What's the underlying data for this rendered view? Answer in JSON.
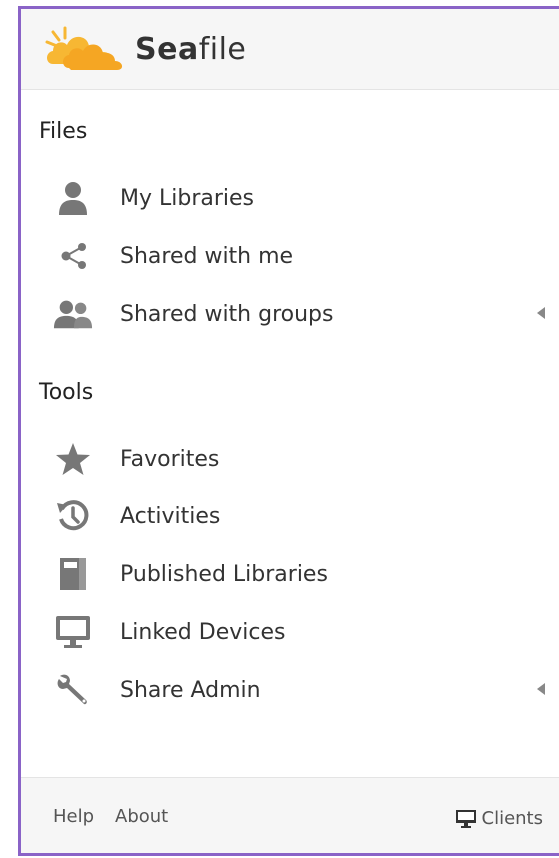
{
  "brand": {
    "name_bold": "Sea",
    "name_rest": "file",
    "logo_colors": [
      "#f5a623",
      "#f7b733"
    ]
  },
  "colors": {
    "frame_border": "#8a63c7",
    "icon_gray": "#777777",
    "text": "#333333"
  },
  "files_section": {
    "title": "Files",
    "items": [
      {
        "label": "My Libraries",
        "icon": "user-icon",
        "has_caret": false
      },
      {
        "label": "Shared with me",
        "icon": "share-icon",
        "has_caret": false
      },
      {
        "label": "Shared with groups",
        "icon": "group-icon",
        "has_caret": true
      }
    ]
  },
  "tools_section": {
    "title": "Tools",
    "items": [
      {
        "label": "Favorites",
        "icon": "star-icon",
        "has_caret": false
      },
      {
        "label": "Activities",
        "icon": "history-icon",
        "has_caret": false
      },
      {
        "label": "Published Libraries",
        "icon": "book-icon",
        "has_caret": false
      },
      {
        "label": "Linked Devices",
        "icon": "monitor-icon",
        "has_caret": false
      },
      {
        "label": "Share Admin",
        "icon": "wrench-icon",
        "has_caret": true
      }
    ]
  },
  "footer": {
    "help": "Help",
    "about": "About",
    "clients": "Clients",
    "clients_icon": "desktop-icon"
  }
}
